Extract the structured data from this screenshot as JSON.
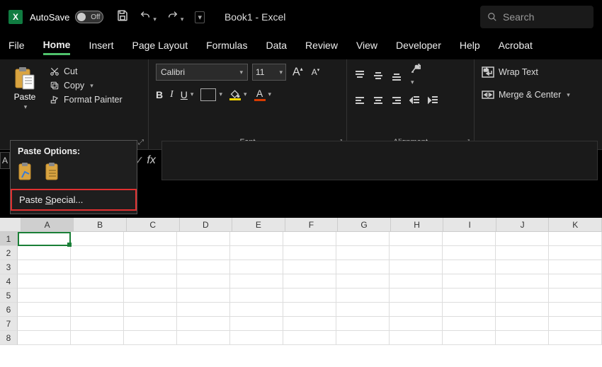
{
  "app": {
    "title": "Book1 - Excel",
    "autosave_label": "AutoSave",
    "autosave_state": "Off",
    "search_placeholder": "Search"
  },
  "tabs": {
    "file": "File",
    "home": "Home",
    "insert": "Insert",
    "page_layout": "Page Layout",
    "formulas": "Formulas",
    "data": "Data",
    "review": "Review",
    "view": "View",
    "developer": "Developer",
    "help": "Help",
    "acrobat": "Acrobat"
  },
  "clipboard": {
    "paste": "Paste",
    "cut": "Cut",
    "copy": "Copy",
    "format_painter": "Format Painter"
  },
  "paste_popup": {
    "header": "Paste Options:",
    "paste_special": "Paste Special..."
  },
  "font": {
    "group_label": "Font",
    "name": "Calibri",
    "size": "11",
    "increase": "A",
    "decrease": "A",
    "bold": "B",
    "italic": "I",
    "underline": "U",
    "font_color_letter": "A"
  },
  "alignment": {
    "group_label": "Alignment"
  },
  "wrap": {
    "wrap_text": "Wrap Text",
    "merge_center": "Merge & Center"
  },
  "namebox": {
    "value": "A",
    "fx": "fx"
  },
  "grid": {
    "columns": [
      "A",
      "B",
      "C",
      "D",
      "E",
      "F",
      "G",
      "H",
      "I",
      "J",
      "K"
    ],
    "rows": [
      "1",
      "2",
      "3",
      "4",
      "5",
      "6",
      "7",
      "8"
    ],
    "selected_col": "A",
    "selected_row": "1"
  },
  "colors": {
    "accent": "#4fc26b",
    "fill_highlight": "#ffd800",
    "font_color": "#d83b01",
    "selection": "#1a7f37"
  }
}
